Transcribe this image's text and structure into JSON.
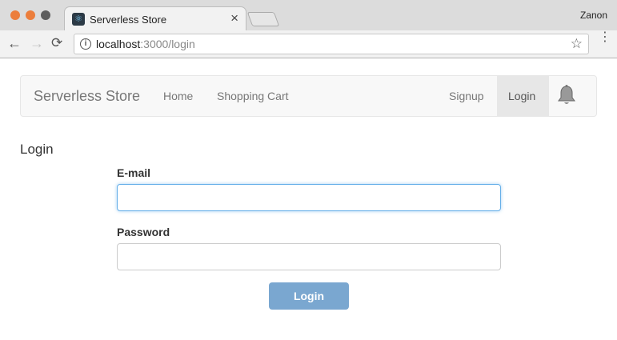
{
  "browser": {
    "tab_title": "Serverless Store",
    "tab_close": "×",
    "profile_name": "Zanon",
    "url_host": "localhost",
    "url_path": ":3000/login",
    "icons": {
      "back": "←",
      "forward": "→",
      "reload": "⟳",
      "info": "i",
      "bookmark": "☆",
      "menu": "⋮"
    }
  },
  "navbar": {
    "brand": "Serverless Store",
    "links": {
      "home": "Home",
      "cart": "Shopping Cart",
      "signup": "Signup",
      "login": "Login"
    }
  },
  "form": {
    "heading": "Login",
    "email_label": "E-mail",
    "email_value": "",
    "password_label": "Password",
    "password_value": "",
    "submit_label": "Login"
  },
  "colors": {
    "accent": "#7aa7d0",
    "focus": "#66afe9",
    "traffic_red": "#ec7e3c",
    "traffic_dark": "#5d5d5d"
  }
}
